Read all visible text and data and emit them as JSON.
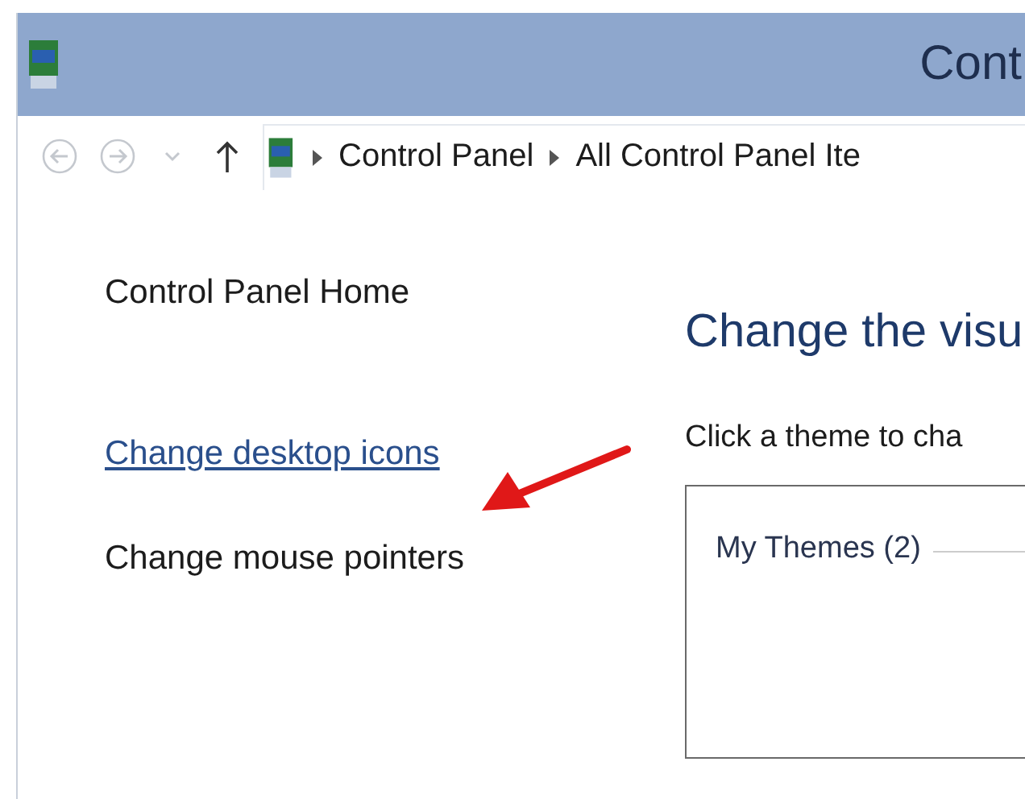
{
  "window": {
    "title": "Cont"
  },
  "address_bar": {
    "nav_buttons": [
      {
        "kind": "back",
        "disabled": true
      },
      {
        "kind": "forward",
        "disabled": true
      },
      {
        "kind": "recent",
        "disabled": true
      },
      {
        "kind": "up",
        "disabled": false
      }
    ],
    "breadcrumbs": [
      "Control Panel",
      "All Control Panel Ite"
    ]
  },
  "sidebar": {
    "items": [
      {
        "label": "Control Panel Home",
        "kind": "text"
      },
      {
        "label": "Change desktop icons",
        "kind": "link"
      },
      {
        "label": "Change mouse pointers",
        "kind": "text"
      }
    ]
  },
  "content": {
    "heading": "Change the visu",
    "instruction": "Click a theme to cha",
    "theme_group": {
      "label": "My Themes (2)"
    }
  }
}
